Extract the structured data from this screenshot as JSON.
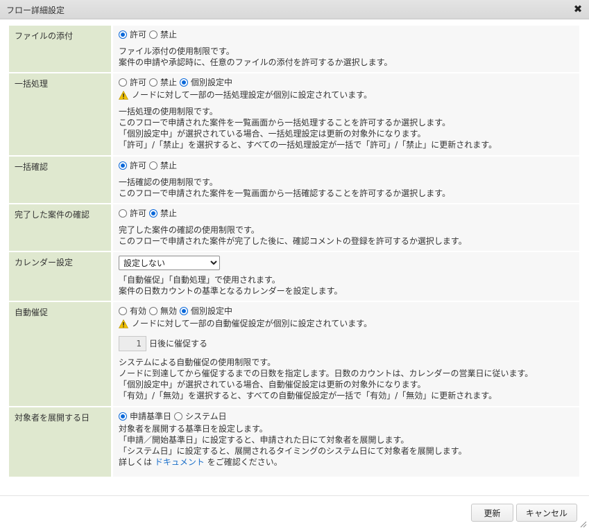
{
  "dialog": {
    "title": "フロー詳細設定",
    "close_symbol": "✖",
    "close_icon": "close-icon"
  },
  "rows": {
    "attach": {
      "label": "ファイルの添付",
      "options": [
        {
          "label": "許可",
          "selected": true
        },
        {
          "label": "禁止",
          "selected": false
        }
      ],
      "desc": [
        "ファイル添付の使用制限です。",
        "案件の申請や承認時に、任意のファイルの添付を許可するか選択します。"
      ]
    },
    "bulk": {
      "label": "一括処理",
      "options": [
        {
          "label": "許可",
          "selected": false
        },
        {
          "label": "禁止",
          "selected": false
        },
        {
          "label": "個別設定中",
          "selected": true
        }
      ],
      "warning": "ノードに対して一部の一括処理設定が個別に設定されています。",
      "desc": [
        "一括処理の使用制限です。",
        "このフローで申請された案件を一覧画面から一括処理することを許可するか選択します。",
        "「個別設定中」が選択されている場合、一括処理設定は更新の対象外になります。",
        "「許可」/「禁止」を選択すると、すべての一括処理設定が一括で「許可」/「禁止」に更新されます。"
      ]
    },
    "bulk_confirm": {
      "label": "一括確認",
      "options": [
        {
          "label": "許可",
          "selected": true
        },
        {
          "label": "禁止",
          "selected": false
        }
      ],
      "desc": [
        "一括確認の使用制限です。",
        "このフローで申請された案件を一覧画面から一括確認することを許可するか選択します。"
      ]
    },
    "completed": {
      "label": "完了した案件の確認",
      "options": [
        {
          "label": "許可",
          "selected": false
        },
        {
          "label": "禁止",
          "selected": true
        }
      ],
      "desc": [
        "完了した案件の確認の使用制限です。",
        "このフローで申請された案件が完了した後に、確認コメントの登録を許可するか選択します。"
      ]
    },
    "calendar": {
      "label": "カレンダー設定",
      "selected": "設定しない",
      "desc": [
        "「自動催促」「自動処理」で使用されます。",
        "案件の日数カウントの基準となるカレンダーを設定します。"
      ]
    },
    "auto_remind": {
      "label": "自動催促",
      "options": [
        {
          "label": "有効",
          "selected": false
        },
        {
          "label": "無効",
          "selected": false
        },
        {
          "label": "個別設定中",
          "selected": true
        }
      ],
      "warning": "ノードに対して一部の自動催促設定が個別に設定されています。",
      "days_value": "1",
      "days_suffix": "日後に催促する",
      "desc": [
        "システムによる自動催促の使用制限です。",
        "ノードに到達してから催促するまでの日数を指定します。日数のカウントは、カレンダーの営業日に従います。",
        "「個別設定中」が選択されている場合、自動催促設定は更新の対象外になります。",
        "「有効」/「無効」を選択すると、すべての自動催促設定が一括で「有効」/「無効」に更新されます。"
      ]
    },
    "expand_date": {
      "label": "対象者を展開する日",
      "options": [
        {
          "label": "申請基準日",
          "selected": true
        },
        {
          "label": "システム日",
          "selected": false
        }
      ],
      "desc": [
        "対象者を展開する基準日を設定します。",
        "「申請／開始基準日」に設定すると、申請された日にて対象者を展開します。",
        "「システム日」に設定すると、展開されるタイミングのシステム日にて対象者を展開します。"
      ],
      "doc_prefix": "詳しくは",
      "doc_link": "ドキュメント",
      "doc_suffix": "をご確認ください。"
    }
  },
  "buttons": {
    "update": "更新",
    "cancel": "キャンセル"
  },
  "colors": {
    "label_bg": "#dfe8cf",
    "value_bg": "#f7f7f7",
    "radio_accent": "#0a68d9",
    "warning": "#f2c200",
    "link": "#1a6fc9"
  }
}
